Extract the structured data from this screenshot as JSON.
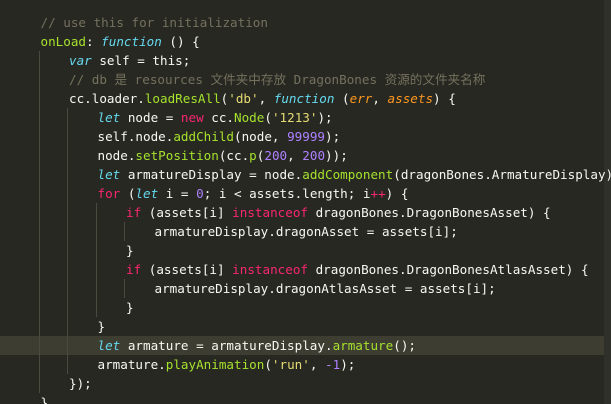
{
  "editor": {
    "language": "javascript",
    "theme": "monokai",
    "current_line_index": 17,
    "lines": [
      {
        "tokens": [
          [
            "cmt",
            "// use this for initialization"
          ]
        ]
      },
      {
        "tokens": [
          [
            "fn",
            "onLoad"
          ],
          [
            "",
            ": "
          ],
          [
            "kw",
            "function"
          ],
          [
            "",
            " () {"
          ]
        ]
      },
      {
        "tokens": [
          [
            "kw",
            "var"
          ],
          [
            "",
            " self = this;"
          ]
        ]
      },
      {
        "tokens": [
          [
            "cmt",
            "// db 是 resources 文件夹中存放 DragonBones 资源的文件夹名称"
          ]
        ]
      },
      {
        "tokens": [
          [
            "",
            "cc.loader."
          ],
          [
            "prop",
            "loadResAll"
          ],
          [
            "",
            "("
          ],
          [
            "str",
            "'db'"
          ],
          [
            "",
            ", "
          ],
          [
            "kw",
            "function"
          ],
          [
            "",
            " ("
          ],
          [
            "param",
            "err"
          ],
          [
            "",
            ", "
          ],
          [
            "param",
            "assets"
          ],
          [
            "",
            ") {"
          ]
        ]
      },
      {
        "tokens": [
          [
            "kw",
            "let"
          ],
          [
            "",
            " node = "
          ],
          [
            "kw2",
            "new"
          ],
          [
            "",
            " cc."
          ],
          [
            "fn",
            "Node"
          ],
          [
            "",
            "("
          ],
          [
            "str",
            "'1213'"
          ],
          [
            "",
            ");"
          ]
        ]
      },
      {
        "tokens": [
          [
            "",
            "self.node."
          ],
          [
            "prop",
            "addChild"
          ],
          [
            "",
            "(node, "
          ],
          [
            "num",
            "99999"
          ],
          [
            "",
            ");"
          ]
        ]
      },
      {
        "tokens": [
          [
            "",
            "node."
          ],
          [
            "prop",
            "setPosition"
          ],
          [
            "",
            "(cc."
          ],
          [
            "prop",
            "p"
          ],
          [
            "",
            "("
          ],
          [
            "num",
            "200"
          ],
          [
            "",
            ", "
          ],
          [
            "num",
            "200"
          ],
          [
            "",
            "));"
          ]
        ]
      },
      {
        "tokens": [
          [
            "kw",
            "let"
          ],
          [
            "",
            " armatureDisplay = node."
          ],
          [
            "prop",
            "addComponent"
          ],
          [
            "",
            "(dragonBones.ArmatureDisplay);"
          ]
        ]
      },
      {
        "tokens": [
          [
            "kw2",
            "for"
          ],
          [
            "",
            " ("
          ],
          [
            "kw",
            "let"
          ],
          [
            "",
            " i = "
          ],
          [
            "num",
            "0"
          ],
          [
            "",
            "; i < assets.length; i"
          ],
          [
            "kw2",
            "++"
          ],
          [
            "",
            ") {"
          ]
        ]
      },
      {
        "tokens": [
          [
            "kw2",
            "if"
          ],
          [
            "",
            " (assets[i] "
          ],
          [
            "kw2",
            "instanceof"
          ],
          [
            "",
            " dragonBones.DragonBonesAsset) {"
          ]
        ]
      },
      {
        "tokens": [
          [
            "",
            "armatureDisplay.dragonAsset = assets[i];"
          ]
        ]
      },
      {
        "tokens": [
          [
            "",
            "}"
          ]
        ]
      },
      {
        "tokens": [
          [
            "kw2",
            "if"
          ],
          [
            "",
            " (assets[i] "
          ],
          [
            "kw2",
            "instanceof"
          ],
          [
            "",
            " dragonBones.DragonBonesAtlasAsset) {"
          ]
        ]
      },
      {
        "tokens": [
          [
            "",
            "armatureDisplay.dragonAtlasAsset = assets[i];"
          ]
        ]
      },
      {
        "tokens": [
          [
            "",
            "}"
          ]
        ]
      },
      {
        "tokens": [
          [
            "",
            "}"
          ]
        ]
      },
      {
        "tokens": [
          [
            "kw",
            "let"
          ],
          [
            "",
            " armature = armatureDisplay."
          ],
          [
            "prop",
            "armature"
          ],
          [
            "",
            "();"
          ]
        ]
      },
      {
        "tokens": [
          [
            "",
            "armature."
          ],
          [
            "prop",
            "playAnimation"
          ],
          [
            "",
            "("
          ],
          [
            "str",
            "'run'"
          ],
          [
            "",
            ", "
          ],
          [
            "num",
            "-1"
          ],
          [
            "",
            ");"
          ]
        ]
      },
      {
        "tokens": [
          [
            "",
            "});"
          ]
        ]
      },
      {
        "tokens": [
          [
            "",
            "},"
          ]
        ]
      }
    ]
  },
  "colors": {
    "background": "#272822",
    "current_line": "#3e3d32",
    "comment": "#75715e",
    "keyword_storage": "#66d9ef",
    "keyword_control": "#f92672",
    "function": "#a6e22e",
    "string": "#e6db74",
    "number": "#ae81ff",
    "parameter": "#fd971f"
  }
}
